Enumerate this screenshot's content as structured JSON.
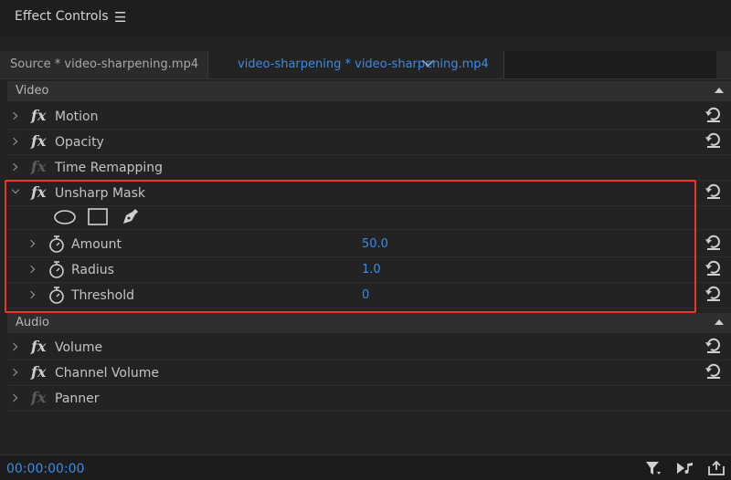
{
  "panel": {
    "title": "Effect Controls",
    "menu_icon": "hamburger-icon"
  },
  "tabs": {
    "source": "Source * video-sharpening.mp4",
    "sequence": "video-sharpening * video-sharpening.mp4"
  },
  "video": {
    "header": "Video",
    "effects": [
      {
        "label": "Motion",
        "fx_enabled": true,
        "resettable": true
      },
      {
        "label": "Opacity",
        "fx_enabled": true,
        "resettable": true
      },
      {
        "label": "Time Remapping",
        "fx_enabled": false,
        "resettable": false
      },
      {
        "label": "Unsharp Mask",
        "fx_enabled": true,
        "resettable": true,
        "expanded": true
      }
    ],
    "unsharp_params": [
      {
        "label": "Amount",
        "value": "50.0"
      },
      {
        "label": "Radius",
        "value": "1.0"
      },
      {
        "label": "Threshold",
        "value": "0"
      }
    ],
    "mask_tools": [
      "ellipse-mask-icon",
      "rectangle-mask-icon",
      "pen-mask-icon"
    ]
  },
  "audio": {
    "header": "Audio",
    "effects": [
      {
        "label": "Volume",
        "fx_enabled": true,
        "resettable": true
      },
      {
        "label": "Channel Volume",
        "fx_enabled": true,
        "resettable": true
      },
      {
        "label": "Panner",
        "fx_enabled": false,
        "resettable": false
      }
    ]
  },
  "footer": {
    "timecode": "00:00:00:00"
  },
  "colors": {
    "accent": "#3a8ce6",
    "highlight": "#e23b2e",
    "background": "#232323"
  }
}
